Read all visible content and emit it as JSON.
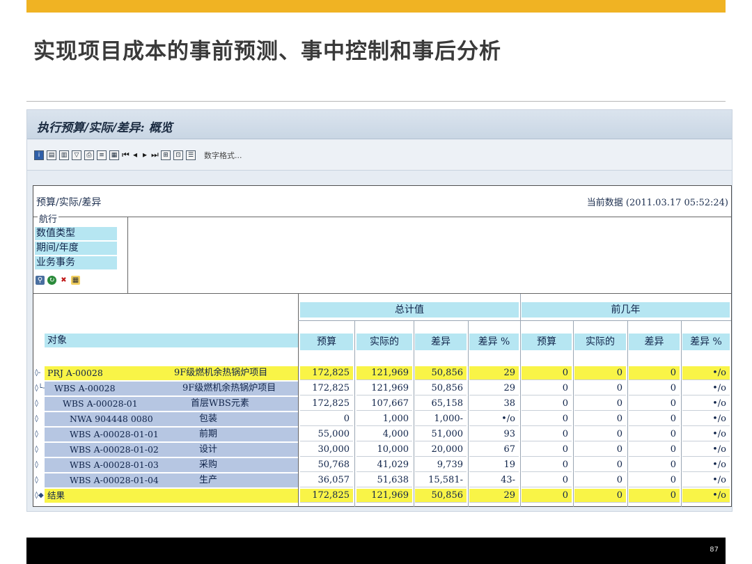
{
  "slide": {
    "title": "实现项目成本的事前预测、事中控制和事后分析",
    "page_number": "87"
  },
  "sap": {
    "window_title": "执行预算/实际/差异: 概览",
    "toolbar_number_format": "数字格式...",
    "report_title": "预算/实际/差异",
    "current_data": "当前数据 (2011.03.17 05:52:24)",
    "nav_legend": "航行",
    "nav_items": [
      "数值类型",
      "期间/年度",
      "业务事务"
    ],
    "object_header": "对象",
    "groups": [
      "总计值",
      "前几年"
    ],
    "columns": [
      "预算",
      "实际的",
      "差异",
      "差异 %",
      "预算",
      "实际的",
      "差异",
      "差异 %"
    ],
    "rows": [
      {
        "marker": "◊-",
        "code": "PRJ A-00028",
        "desc": "9F级燃机余热锅炉项目",
        "vals": [
          "172,825",
          "121,969",
          "50,856",
          "29",
          "0",
          "0",
          "0",
          "•/o"
        ]
      },
      {
        "marker": "◊└-",
        "code": "WBS A-00028",
        "desc": "9F级燃机余热锅炉项目",
        "vals": [
          "172,825",
          "121,969",
          "50,856",
          "29",
          "0",
          "0",
          "0",
          "•/o"
        ]
      },
      {
        "marker": "◊",
        "code": "WBS A-00028-01",
        "desc": "首层WBS元素",
        "vals": [
          "172,825",
          "107,667",
          "65,158",
          "38",
          "0",
          "0",
          "0",
          "•/o"
        ]
      },
      {
        "marker": "◊",
        "code": "NWA 904448 0080",
        "desc": "包装",
        "vals": [
          "0",
          "1,000",
          "1,000-",
          "•/o",
          "0",
          "0",
          "0",
          "•/o"
        ]
      },
      {
        "marker": "◊",
        "code": "WBS A-00028-01-01",
        "desc": "前期",
        "vals": [
          "55,000",
          "4,000",
          "51,000",
          "93",
          "0",
          "0",
          "0",
          "•/o"
        ]
      },
      {
        "marker": "◊",
        "code": "WBS A-00028-01-02",
        "desc": "设计",
        "vals": [
          "30,000",
          "10,000",
          "20,000",
          "67",
          "0",
          "0",
          "0",
          "•/o"
        ]
      },
      {
        "marker": "◊",
        "code": "WBS A-00028-01-03",
        "desc": "采购",
        "vals": [
          "50,768",
          "41,029",
          "9,739",
          "19",
          "0",
          "0",
          "0",
          "•/o"
        ]
      },
      {
        "marker": "◊",
        "code": "WBS A-00028-01-04",
        "desc": "生产",
        "vals": [
          "36,057",
          "51,638",
          "15,581-",
          "43-",
          "0",
          "0",
          "0",
          "•/o"
        ]
      },
      {
        "marker": "◊◆",
        "code": "结果",
        "desc": "",
        "vals": [
          "172,825",
          "121,969",
          "50,856",
          "29",
          "0",
          "0",
          "0",
          "•/o"
        ]
      }
    ]
  },
  "colors": {
    "accent": "#f0b323",
    "highlight": "#f9f447",
    "header": "#b6e6f2",
    "object": "#b6c6e2"
  }
}
